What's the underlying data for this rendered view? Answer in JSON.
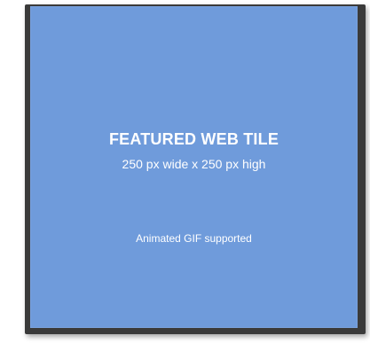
{
  "tile": {
    "title": "FEATURED WEB TILE",
    "subtitle": "250 px wide x 250 px high",
    "note": "Animated GIF supported",
    "background_color": "#6f9bdb",
    "frame_color": "#3a3a3a"
  }
}
